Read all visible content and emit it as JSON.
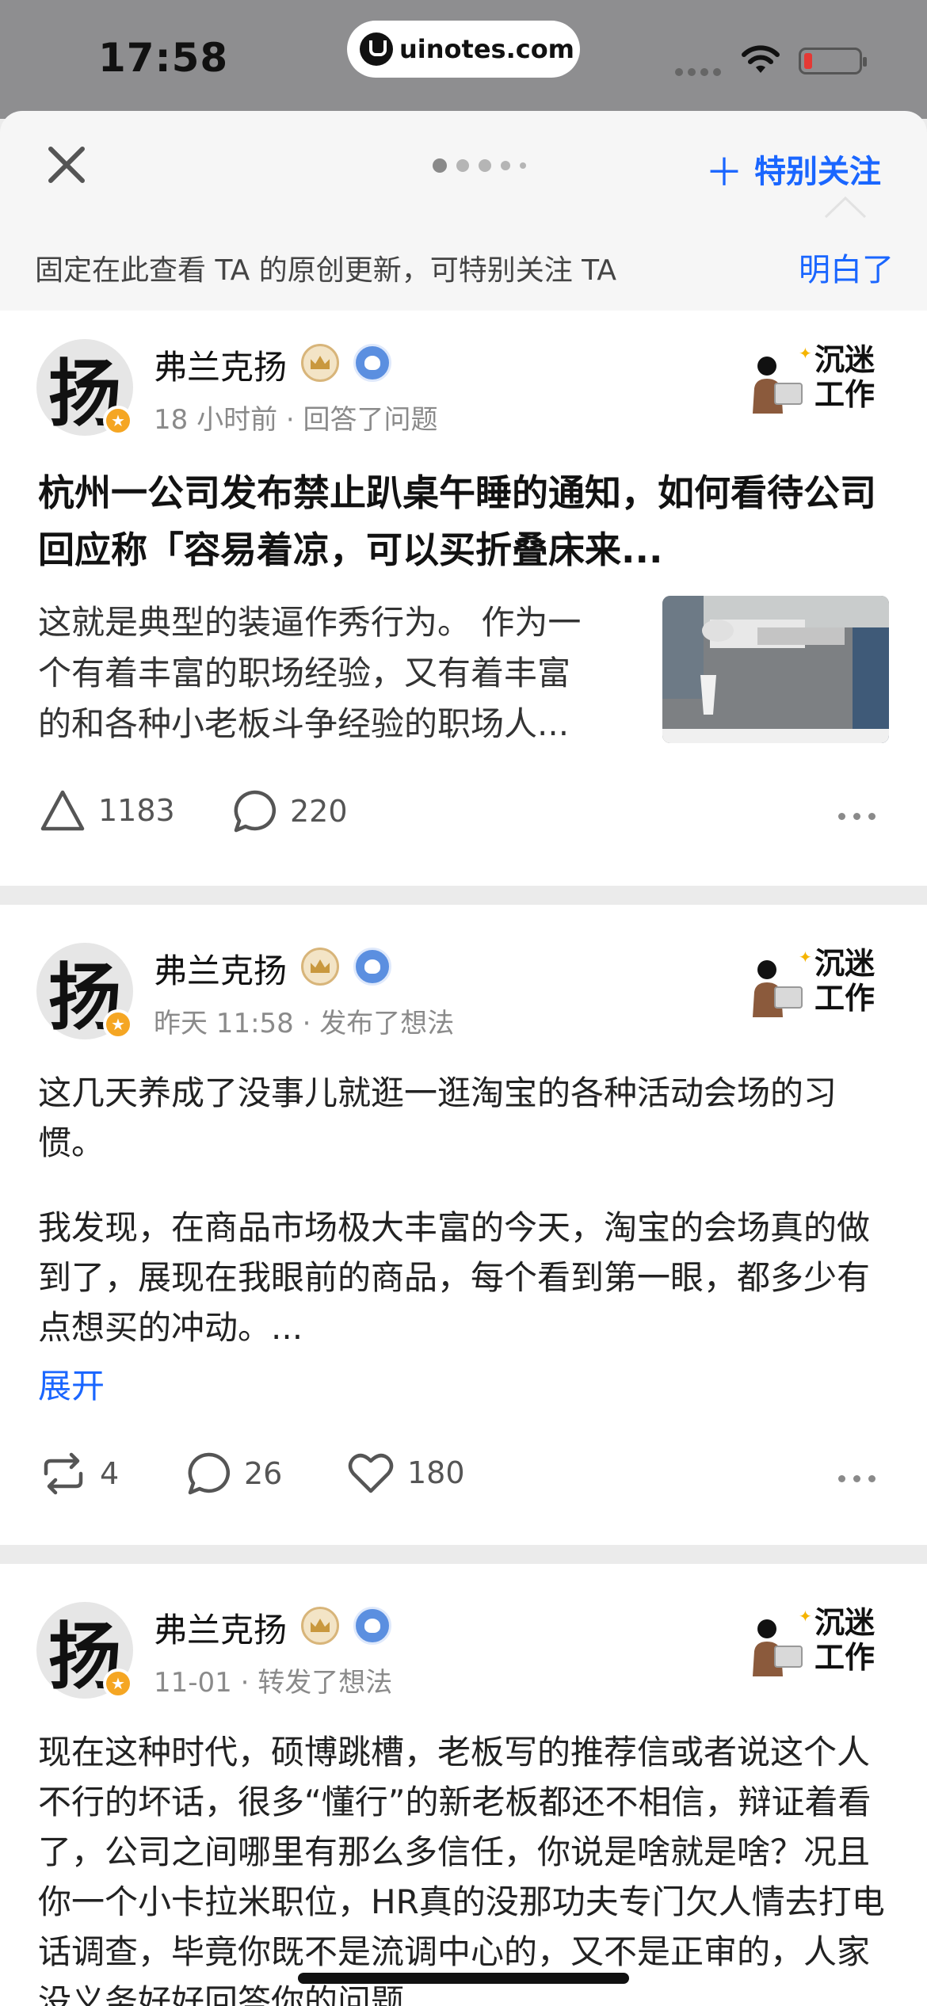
{
  "status_bar": {
    "time": "17:58",
    "url": "uinotes.com"
  },
  "header": {
    "close_icon": "close-icon",
    "follow_label": "特别关注",
    "tip_text": "固定在此查看 TA 的原创更新，可特别关注 TA",
    "tip_ok": "明白了"
  },
  "brand": {
    "text_line1": "沉迷",
    "text_line2": "工作"
  },
  "feed": [
    {
      "author": "弗兰克扬",
      "avatar_char": "扬",
      "meta": "18 小时前 · 回答了问题",
      "title": "杭州一公司发布禁止趴桌午睡的通知，如何看待公司回应称「容易着凉，可以买折叠床来...",
      "excerpt_line1": "这就是典型的装逼作秀行为。 作为一",
      "excerpt_line2": "个有着丰富的职场经验，又有着丰富",
      "excerpt_line3": "的和各种小老板斗争经验的职场人...",
      "upvotes": "1183",
      "comments": "220"
    },
    {
      "author": "弗兰克扬",
      "avatar_char": "扬",
      "meta": "昨天 11:58 · 发布了想法",
      "para1": "这几天养成了没事儿就逛一逛淘宝的各种活动会场的习惯。",
      "para2": "我发现，在商品市场极大丰富的今天，淘宝的会场真的做到了，展现在我眼前的商品，每个看到第一眼，都多少有点想买的冲动。...",
      "expand": "展开",
      "reposts": "4",
      "comments": "26",
      "likes": "180"
    },
    {
      "author": "弗兰克扬",
      "avatar_char": "扬",
      "meta": "11-01 · 转发了想法",
      "para1": "现在这种时代，硕博跳槽，老板写的推荐信或者说这个人不行的坏话，很多“懂行”的新老板都还不相信，辩证着看了，公司之间哪里有那么多信任，你说是啥就是啥？况且你一个小卡拉米职位，HR真的没那功夫专门欠人情去打电话调查，毕竟你既不是流调中心的，又不是正审的，人家没义务好好回答你的问题"
    }
  ]
}
